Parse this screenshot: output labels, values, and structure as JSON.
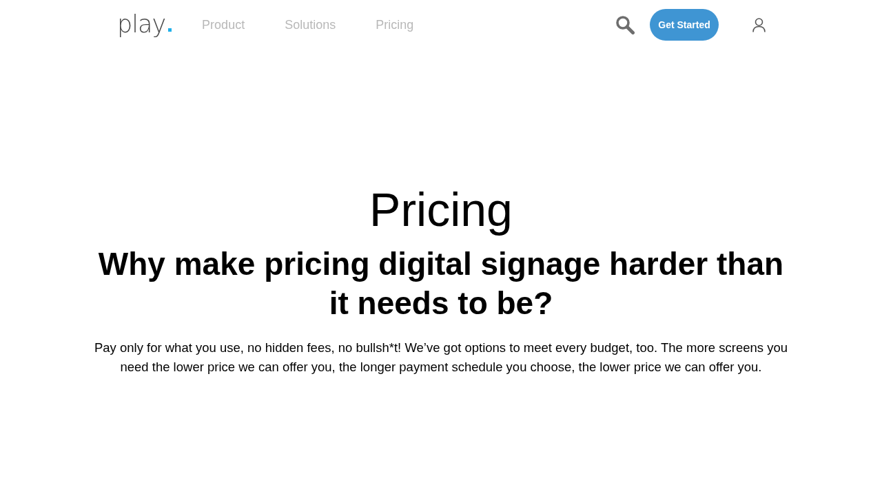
{
  "header": {
    "logo": {
      "text": "play"
    },
    "nav": [
      {
        "label": "Product"
      },
      {
        "label": "Solutions"
      },
      {
        "label": "Pricing"
      }
    ],
    "cta": {
      "label": "Get Started"
    }
  },
  "hero": {
    "title": "Pricing",
    "subtitle": "Why make pricing digital signage harder than it needs to be?",
    "description": "Pay only for what you use, no hidden fees, no bullsh*t! We’ve got options to meet every budget, too. The more screens you need the lower price we can offer you, the longer payment schedule you choose, the lower price we can offer you."
  }
}
